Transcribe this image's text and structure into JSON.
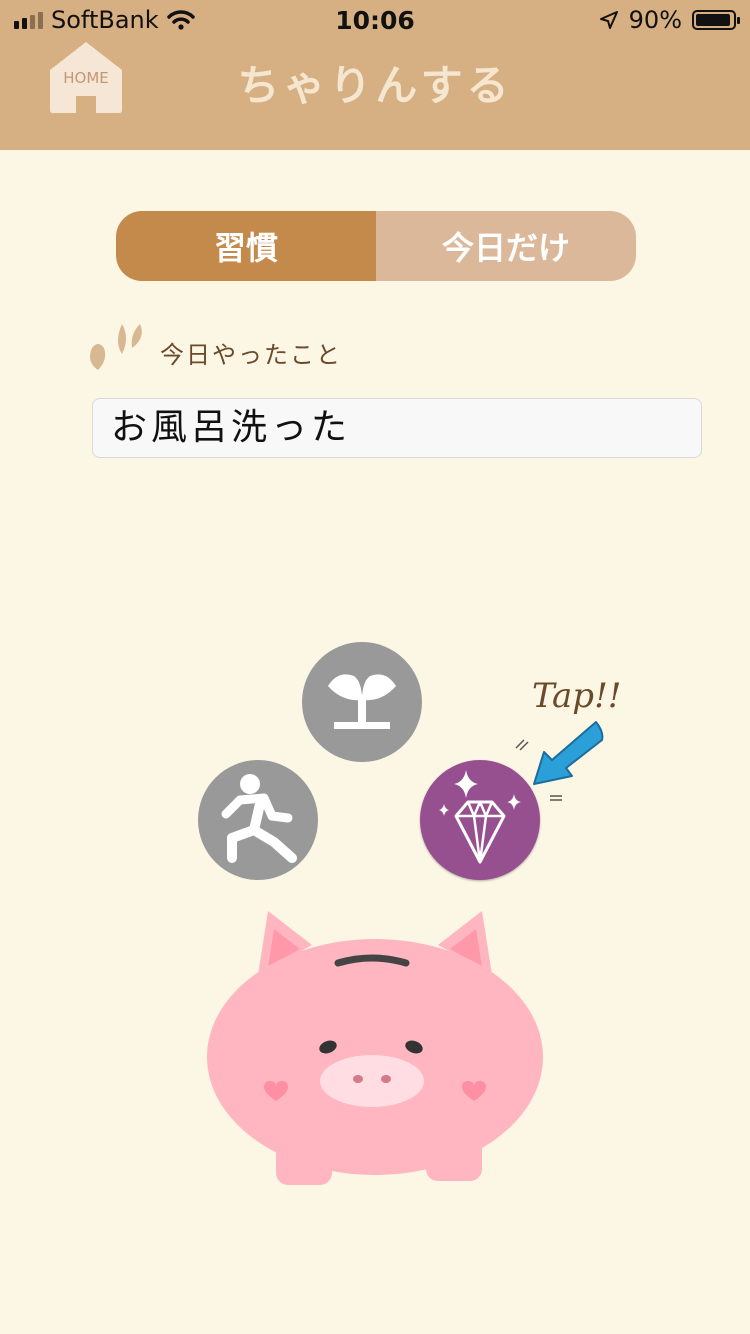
{
  "status_bar": {
    "carrier": "SoftBank",
    "time": "10:06",
    "battery": "90%",
    "battery_level": 0.9
  },
  "header": {
    "home_label": "HOME",
    "title": "ちゃりんする"
  },
  "segment": {
    "habit_label": "習慣",
    "today_label": "今日だけ",
    "selected": "習慣"
  },
  "form": {
    "section_label": "今日やったこと",
    "input_value": "お風呂洗った"
  },
  "tap_hint": "Tap!!",
  "colors": {
    "header": "#d6b083",
    "background": "#fcf6e4",
    "segment_active": "#c48a4b",
    "segment_inactive": "#dbb89a",
    "coin_gray": "#999999",
    "coin_purple": "#96508f",
    "arrow_blue": "#2a9fd8",
    "pig_pink": "#ffb6c1"
  },
  "icons": {
    "coins": [
      "sprout-icon",
      "running-icon",
      "diamond-icon"
    ],
    "home": "home-icon"
  }
}
